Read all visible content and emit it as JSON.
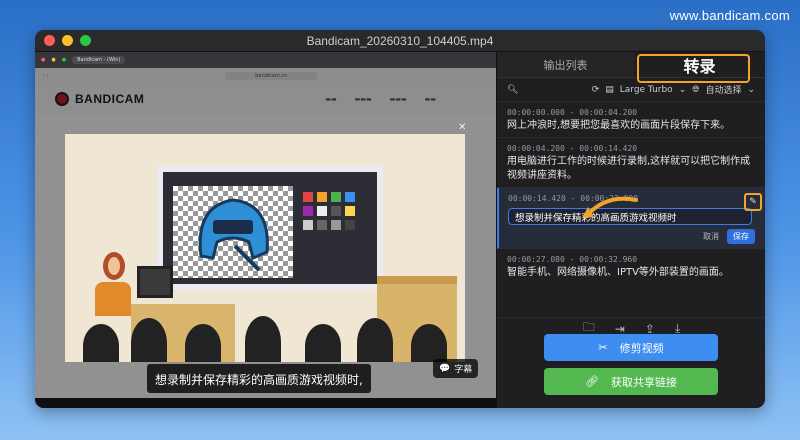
{
  "watermark": "www.bandicam.com",
  "window": {
    "title": "Bandicam_20260310_104405.mp4",
    "traffic_light_colors": [
      "#fe5f57",
      "#febc2e",
      "#28c840"
    ]
  },
  "video": {
    "browser_tab": "Bandicam - (Win)",
    "browser_url": "bandicam.cn",
    "site_logo": "BANDICAM",
    "subtitle_overlay": "想录制并保存精彩的高画质游戏视频时,",
    "subtitle_button_label": "字幕"
  },
  "panel": {
    "tabs": [
      {
        "label": "输出列表",
        "active": false
      },
      {
        "label": "转录",
        "active": true
      }
    ],
    "model_label": "Large Turbo",
    "language_label": "自动选择",
    "segments": [
      {
        "time": "00:00:00.000 - 00:00:04.200",
        "text": "网上冲浪时,想要把您最喜欢的画面片段保存下来。"
      },
      {
        "time": "00:00:04.200 - 00:00:14.420",
        "text": "用电脑进行工作的时候进行录制,这样就可以把它制作成视频讲座资料。"
      },
      {
        "time": "00:00:14.420 - 00:00:22.000",
        "text": "想录制并保存精彩的高画质游戏视频时",
        "editing": true
      },
      {
        "time": "00:00:27.080 - 00:00:32.960",
        "text": "智能手机、网络摄像机、IPTV等外部装置的画面。"
      }
    ],
    "edit": {
      "cancel_label": "取消",
      "save_label": "保存"
    },
    "buttons": {
      "trim": {
        "label": "修剪视频",
        "color": "#3d8ef0"
      },
      "share": {
        "label": "获取共享链接",
        "color": "#52b84f"
      }
    },
    "highlight_color": "#f2a42c"
  }
}
